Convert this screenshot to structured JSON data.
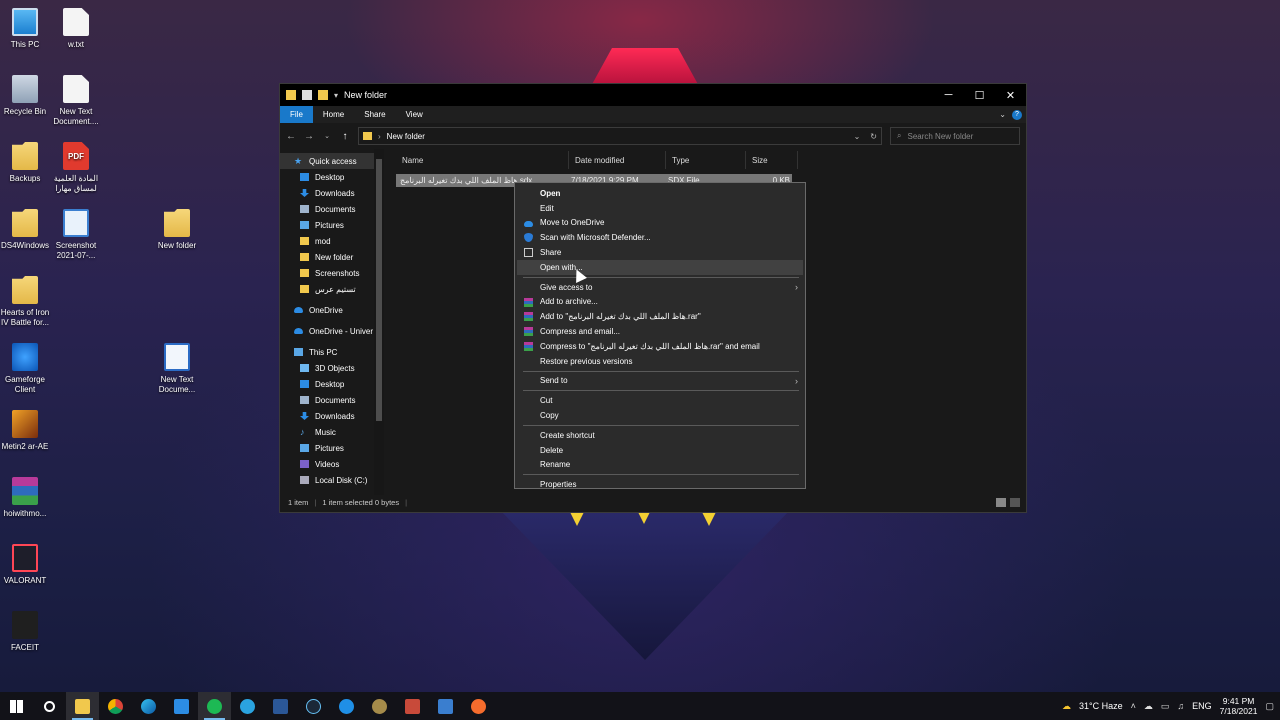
{
  "desktop": {
    "icons": [
      {
        "label": "This PC",
        "icon": "this-pc-icon"
      },
      {
        "label": "w.txt",
        "icon": "text-file-icon"
      },
      {
        "label": "Recycle Bin",
        "icon": "recycle-bin-icon"
      },
      {
        "label": "New Text Document....",
        "icon": "text-file-icon"
      },
      {
        "label": "Backups",
        "icon": "folder-icon"
      },
      {
        "label": "المادة العلمية لمساق مهارا",
        "icon": "pdf-icon"
      },
      {
        "label": "DS4Windows",
        "icon": "folder-icon"
      },
      {
        "label": "Screenshot 2021-07-...",
        "icon": "image-file-icon"
      },
      {
        "label": "New folder",
        "icon": "folder-icon"
      },
      {
        "label": "Hearts of Iron IV Battle for...",
        "icon": "folder-icon"
      },
      {
        "label": "Gameforge Client",
        "icon": "gameforge-icon"
      },
      {
        "label": "New Text Docume...",
        "icon": "text-document-icon"
      },
      {
        "label": "Metin2 ar-AE",
        "icon": "metin2-icon"
      },
      {
        "label": "hoiwithmo...",
        "icon": "winrar-icon"
      },
      {
        "label": "VALORANT",
        "icon": "valorant-icon"
      },
      {
        "label": "FACEIT",
        "icon": "faceit-icon"
      }
    ]
  },
  "explorer": {
    "title": "New folder",
    "ribbon_tabs": [
      "File",
      "Home",
      "Share",
      "View"
    ],
    "address": "New folder",
    "search_placeholder": "Search New folder",
    "nav": {
      "quick_access": "Quick access",
      "qa_items": [
        "Desktop",
        "Downloads",
        "Documents",
        "Pictures",
        "mod",
        "New folder",
        "Screenshots",
        "تستيم عرس"
      ],
      "onedrive": "OneDrive",
      "onedrive_univ": "OneDrive - Univer",
      "this_pc": "This PC",
      "pc_items": [
        "3D Objects",
        "Desktop",
        "Documents",
        "Downloads",
        "Music",
        "Pictures",
        "Videos",
        "Local Disk (C:)"
      ]
    },
    "columns": [
      "Name",
      "Date modified",
      "Type",
      "Size"
    ],
    "file": {
      "name": "هاظ الملف اللي بدك تغيرله البرنامج.sdx",
      "date": "7/18/2021 9:29 PM",
      "type": "SDX File",
      "size": "0 KB"
    },
    "status": {
      "count": "1 item",
      "selected": "1 item selected  0 bytes"
    }
  },
  "context_menu": {
    "open": "Open",
    "edit": "Edit",
    "move_onedrive": "Move to OneDrive",
    "scan": "Scan with Microsoft Defender...",
    "share": "Share",
    "open_with": "Open with...",
    "give_access": "Give access to",
    "add_archive": "Add to archive...",
    "add_to_rar": "Add to \"هاظ الملف اللي بدك تغيرله البرنامج.rar\"",
    "compress_email": "Compress and email...",
    "compress_rar_email": "Compress to \"هاظ الملف اللي بدك تغيرله البرنامج.rar\" and email",
    "restore": "Restore previous versions",
    "send_to": "Send to",
    "cut": "Cut",
    "copy": "Copy",
    "create_shortcut": "Create shortcut",
    "delete": "Delete",
    "rename": "Rename",
    "properties": "Properties"
  },
  "taskbar": {
    "weather": "31°C  Haze",
    "language": "ENG",
    "time": "9:41 PM",
    "date": "7/18/2021"
  }
}
